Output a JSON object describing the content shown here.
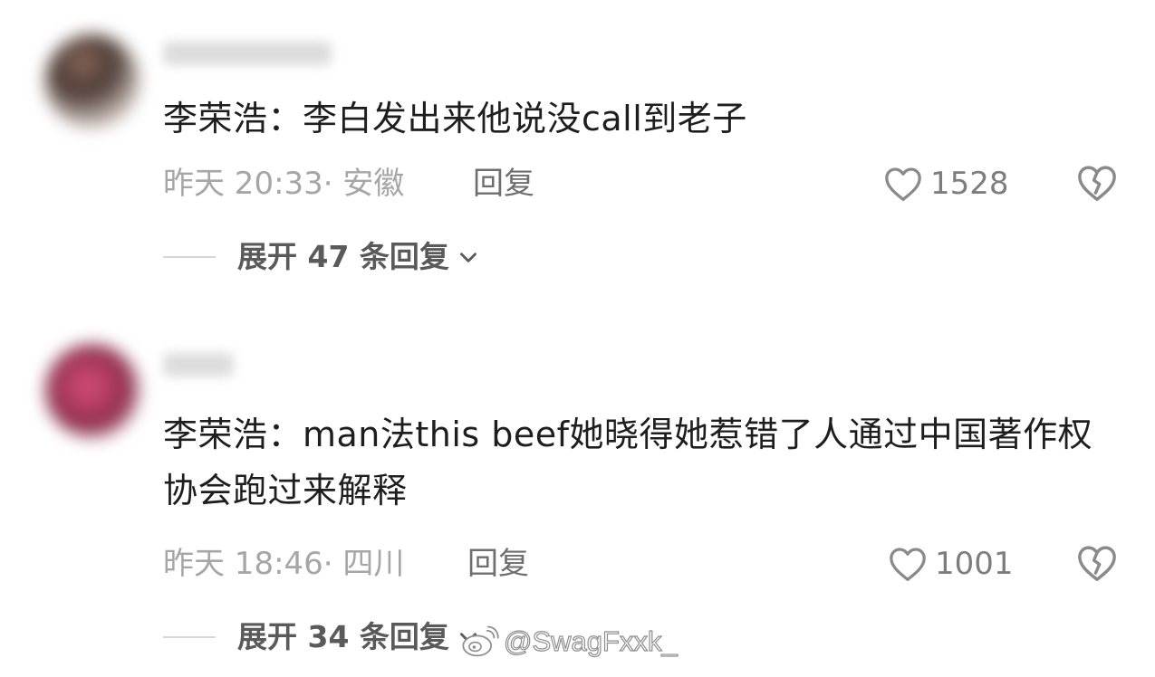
{
  "comments": [
    {
      "text": "李荣浩：李白发出来他说没call到老子",
      "time_location": "昨天 20:33· 安徽",
      "reply_label": "回复",
      "likes": "1528",
      "expand_label": "展开 47 条回复"
    },
    {
      "text": "李荣浩：man法this beef她晓得她惹错了人通过中国著作权协会跑过来解释",
      "time_location": "昨天 18:46· 四川",
      "reply_label": "回复",
      "likes": "1001",
      "expand_label": "展开 34 条回复"
    }
  ],
  "watermark": "@SwagFxxk_",
  "icons": {
    "like": "heart-outline-icon",
    "dislike": "broken-heart-icon",
    "expand": "chevron-down-icon",
    "watermark": "weibo-logo-icon"
  },
  "colors": {
    "text": "#1e1e1e",
    "meta": "#a6a6a6",
    "action": "#6e6e6e"
  }
}
